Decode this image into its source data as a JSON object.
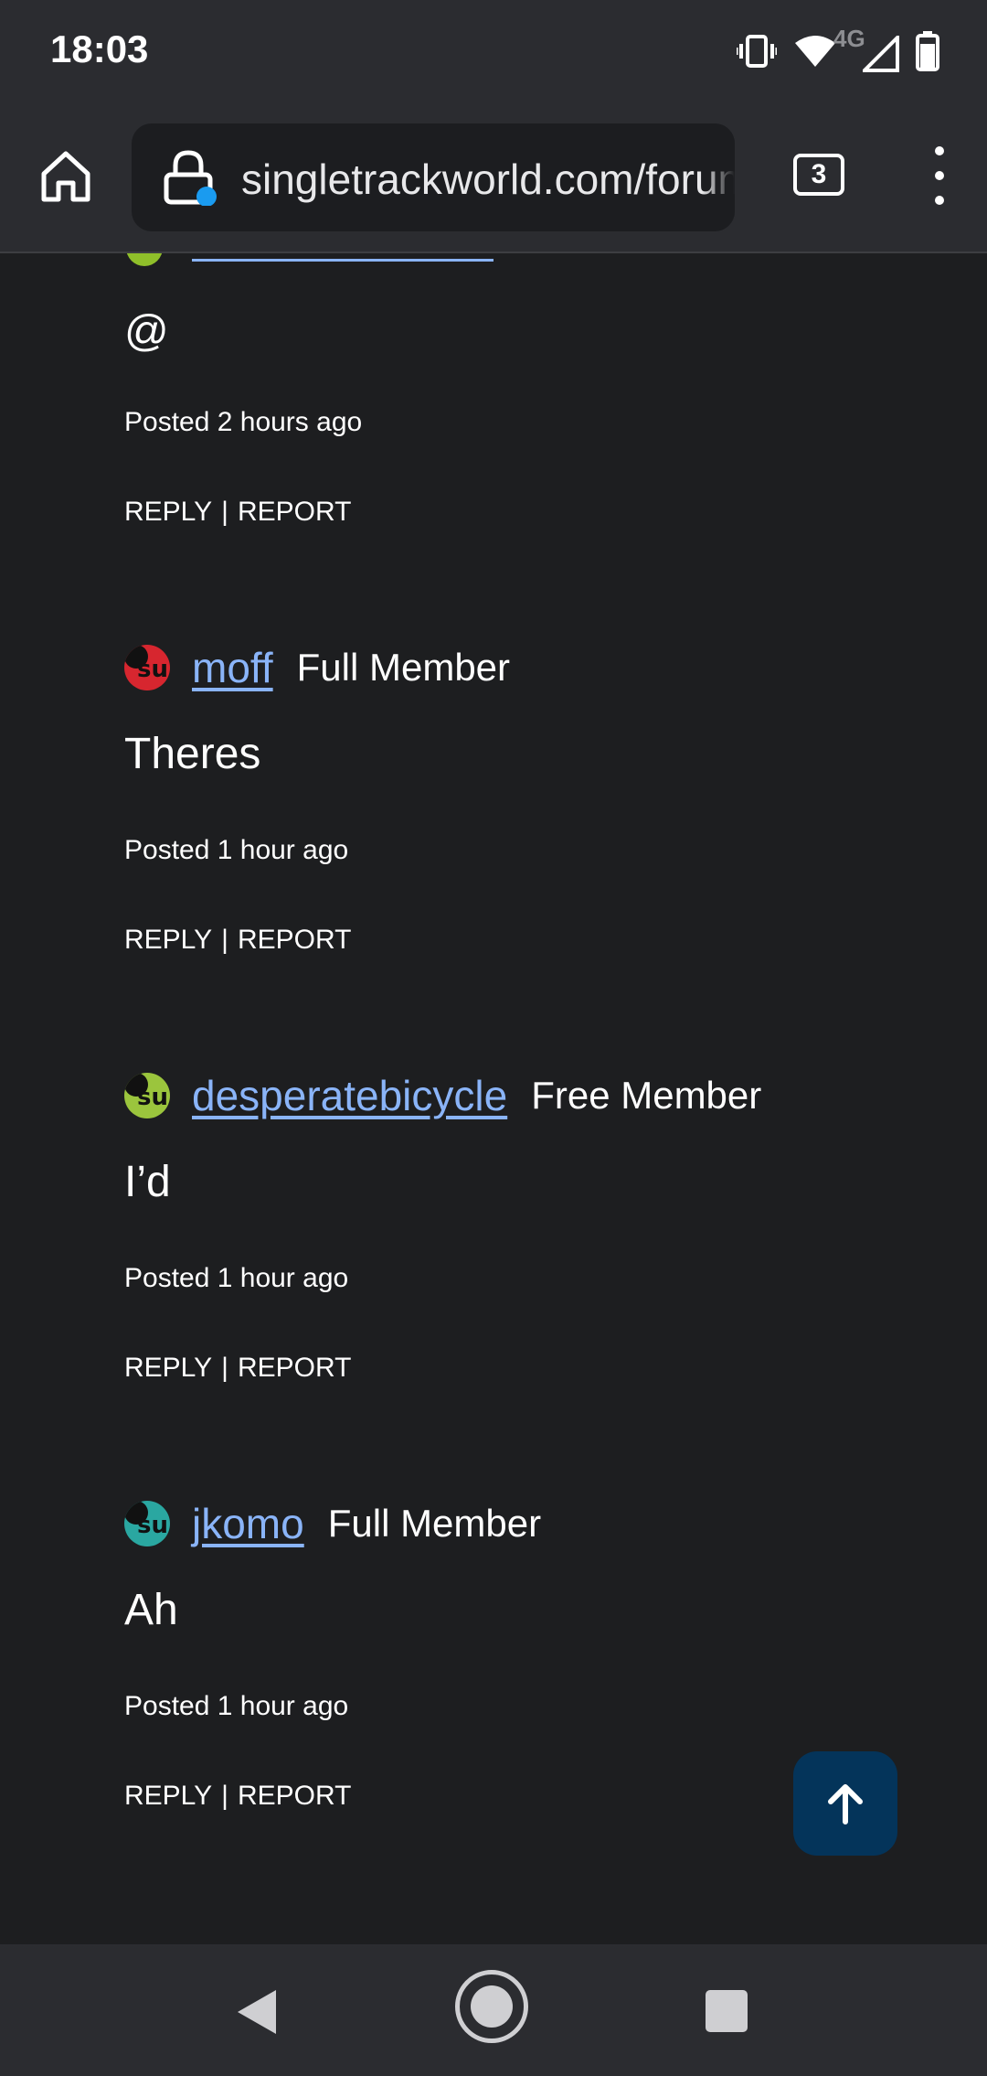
{
  "status_bar": {
    "time": "18:03",
    "network_label": "4G",
    "icons": [
      "vibrate-icon",
      "wifi-icon",
      "signal-icon",
      "battery-icon"
    ]
  },
  "browser": {
    "url": "singletrackworld.com/forum",
    "tab_count": "3",
    "icons": [
      "home-icon",
      "lock-icon",
      "tabs-icon",
      "more-vert-icon"
    ]
  },
  "posts": [
    {
      "text": "@",
      "posted": "Posted 2 hours ago",
      "reply": "REPLY",
      "separator": "|",
      "report": "REPORT"
    },
    {
      "username": "moff",
      "member_type": "Full Member",
      "avatar_color": "#d7262f",
      "text": "Theres",
      "posted": "Posted 1 hour ago",
      "reply": "REPLY",
      "separator": "|",
      "report": "REPORT"
    },
    {
      "username": "desperatebicycle",
      "member_type": "Free Member",
      "avatar_color": "#9bc53d",
      "text": "I’d",
      "posted": "Posted 1 hour ago",
      "reply": "REPLY",
      "separator": "|",
      "report": "REPORT"
    },
    {
      "username": "jkomo",
      "member_type": "Full Member",
      "avatar_color": "#2aa7a1",
      "text": "Ah",
      "posted": "Posted 1 hour ago",
      "reply": "REPLY",
      "separator": "|",
      "report": "REPORT"
    }
  ],
  "scroll_top": {
    "icon": "arrow-up-icon",
    "color": "#04345a"
  },
  "nav_bar": {
    "icons": [
      "back-icon",
      "home-circle-icon",
      "recents-icon"
    ]
  },
  "colors": {
    "background": "#1d1e20",
    "toolbar": "#2b2c30",
    "link": "#8ab4f8"
  }
}
